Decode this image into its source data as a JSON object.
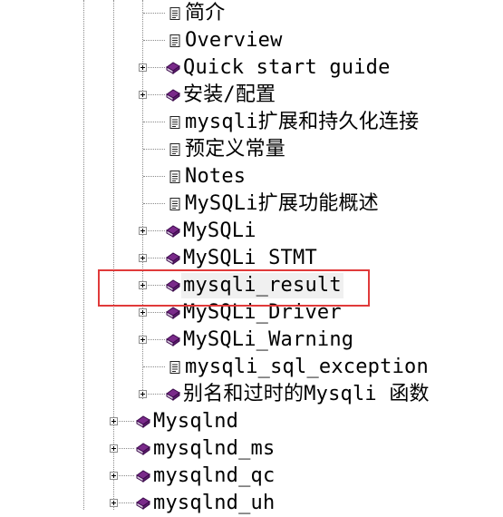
{
  "tree": {
    "items": [
      {
        "label": "简介",
        "icon": "page-icon",
        "level": 2,
        "expandable": false
      },
      {
        "label": "Overview",
        "icon": "page-icon",
        "level": 2,
        "expandable": false
      },
      {
        "label": "Quick start guide",
        "icon": "book-icon",
        "level": 2,
        "expandable": true
      },
      {
        "label": "安装/配置",
        "icon": "book-icon",
        "level": 2,
        "expandable": true
      },
      {
        "label": "mysqli扩展和持久化连接",
        "icon": "page-icon",
        "level": 2,
        "expandable": false
      },
      {
        "label": "预定义常量",
        "icon": "page-icon",
        "level": 2,
        "expandable": false
      },
      {
        "label": "Notes",
        "icon": "page-icon",
        "level": 2,
        "expandable": false
      },
      {
        "label": "MySQLi扩展功能概述",
        "icon": "page-icon",
        "level": 2,
        "expandable": false
      },
      {
        "label": "MySQLi",
        "icon": "book-icon",
        "level": 2,
        "expandable": true
      },
      {
        "label": "MySQLi STMT",
        "icon": "book-icon",
        "level": 2,
        "expandable": true
      },
      {
        "label": "mysqli_result",
        "icon": "book-icon",
        "level": 2,
        "expandable": true,
        "selected": true
      },
      {
        "label": "MySQLi_Driver",
        "icon": "book-icon",
        "level": 2,
        "expandable": true
      },
      {
        "label": "MySQLi_Warning",
        "icon": "book-icon",
        "level": 2,
        "expandable": true
      },
      {
        "label": "mysqli_sql_exception",
        "icon": "page-icon",
        "level": 2,
        "expandable": false
      },
      {
        "label": "别名和过时的Mysqli 函数",
        "icon": "book-icon",
        "level": 2,
        "expandable": true
      },
      {
        "label": "Mysqlnd",
        "icon": "book-icon",
        "level": 1,
        "expandable": true
      },
      {
        "label": "mysqlnd_ms",
        "icon": "book-icon",
        "level": 1,
        "expandable": true
      },
      {
        "label": "mysqlnd_qc",
        "icon": "book-icon",
        "level": 1,
        "expandable": true
      },
      {
        "label": "mysqlnd_uh",
        "icon": "book-icon",
        "level": 1,
        "expandable": true
      }
    ]
  },
  "colors": {
    "highlight_border": "#e03a3a",
    "book_icon": "#7a2a8a",
    "selected_background": "#f0f0f0"
  }
}
